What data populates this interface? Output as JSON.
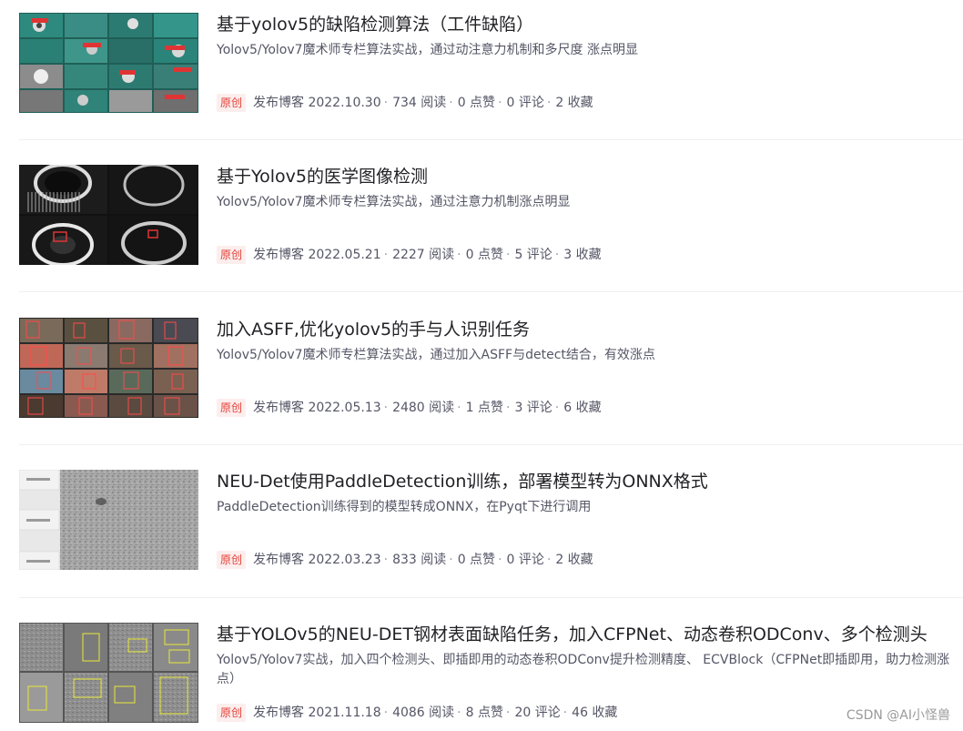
{
  "articles": [
    {
      "title": "基于yolov5的缺陷检测算法（工件缺陷）",
      "desc": "Yolov5/Yolov7魔术师专栏算法实战，通过动注意力机制和多尺度 涨点明显",
      "badge": "原创",
      "date": "发布博客 2022.10.30",
      "reads": "734 阅读",
      "likes": "0 点赞",
      "comments": "0 评论",
      "favorites": "2 收藏",
      "thumb": "teal-grid"
    },
    {
      "title": "基于Yolov5的医学图像检测",
      "desc": "Yolov5/Yolov7魔术师专栏算法实战，通过注意力机制涨点明显",
      "badge": "原创",
      "date": "发布博客 2022.05.21",
      "reads": "2227 阅读",
      "likes": "0 点赞",
      "comments": "5 评论",
      "favorites": "3 收藏",
      "thumb": "ct-scan"
    },
    {
      "title": "加入ASFF,优化yolov5的手与人识别任务",
      "desc": "Yolov5/Yolov7魔术师专栏算法实战，通过加入ASFF与detect结合，有效涨点",
      "badge": "原创",
      "date": "发布博客 2022.05.13",
      "reads": "2480 阅读",
      "likes": "1 点赞",
      "comments": "3 评论",
      "favorites": "6 收藏",
      "thumb": "people-grid"
    },
    {
      "title": "NEU-Det使用PaddleDetection训练，部署模型转为ONNX格式",
      "desc": "PaddleDetection训练得到的模型转成ONNX，在Pyqt下进行调用",
      "badge": "原创",
      "date": "发布博客 2022.03.23",
      "reads": "833 阅读",
      "likes": "0 点赞",
      "comments": "0 评论",
      "favorites": "2 收藏",
      "thumb": "steel-texture"
    },
    {
      "title": "基于YOLOv5的NEU-DET钢材表面缺陷任务，加入CFPNet、动态卷积ODConv、多个检测头",
      "desc": "Yolov5/Yolov7实战，加入四个检测头、即插即用的动态卷积ODConv提升检测精度、 ECVBlock（CFPNet即插即用，助力检测涨点）",
      "badge": "原创",
      "date": "发布博客 2021.11.18",
      "reads": "4086 阅读",
      "likes": "8 点赞",
      "comments": "20 评论",
      "favorites": "46 收藏",
      "thumb": "gray-grid"
    }
  ],
  "watermark": "CSDN @AI小怪兽",
  "colors": {
    "badge_text": "#e33e33",
    "badge_bg": "#fdeeee",
    "title": "#222226",
    "meta": "#555666"
  }
}
